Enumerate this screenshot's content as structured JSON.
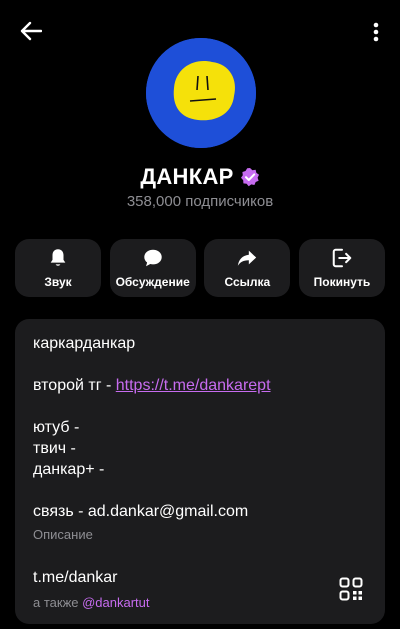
{
  "header": {
    "back_icon": "arrow-left-icon",
    "more_icon": "more-vertical-icon"
  },
  "profile": {
    "title": "ДАНКАР",
    "verified_icon": "verified-badge-icon",
    "verified_color": "#c76cf0",
    "subscribers": "358,000 подписчиков"
  },
  "actions": [
    {
      "label": "Звук",
      "icon": "bell-icon"
    },
    {
      "label": "Обсуждение",
      "icon": "chat-bubble-icon"
    },
    {
      "label": "Ссылка",
      "icon": "share-arrow-icon"
    },
    {
      "label": "Покинуть",
      "icon": "exit-icon"
    }
  ],
  "info": {
    "line1": "каркарданкар",
    "line2_prefix": "второй тг - ",
    "line2_link": "https://t.me/dankarept",
    "line3": "ютуб -",
    "line4": "твич -",
    "line5": "данкар+ -",
    "line6": "связь - ad.dankar@gmail.com",
    "description_caption": "Описание",
    "username": "t.me/dankar",
    "also_prefix": "а также ",
    "also_mention": "@dankartut",
    "qr_icon": "qr-code-icon"
  },
  "colors": {
    "background": "#000000",
    "card": "#1c1c1e",
    "accent": "#c76cf0",
    "muted": "#8e8e93",
    "avatar_blue": "#1e4fd8",
    "avatar_yellow": "#f5e10a"
  }
}
